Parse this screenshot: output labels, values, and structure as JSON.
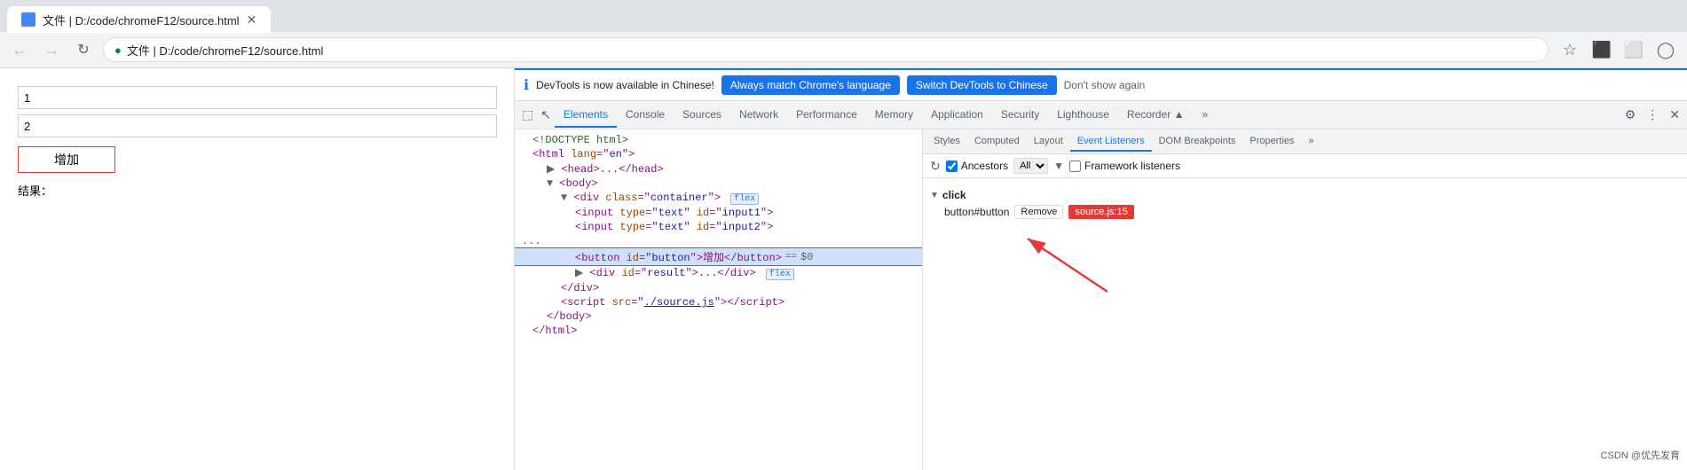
{
  "browser": {
    "tab_title": "文件 | D:/code/chromeF12/source.html",
    "address": "文件 | D:/code/chromeF12/source.html",
    "address_protocol": "文件",
    "address_path": "D:/code/chromeF12/source.html"
  },
  "page": {
    "input1_value": "1",
    "input2_value": "2",
    "button_label": "增加",
    "result_label": "结果："
  },
  "infobar": {
    "message": "DevTools is now available in Chinese!",
    "btn1": "Always match Chrome's language",
    "btn2": "Switch DevTools to Chinese",
    "dont_show": "Don't show again"
  },
  "devtools_tabs": {
    "tabs": [
      {
        "label": "Elements",
        "active": true
      },
      {
        "label": "Console",
        "active": false
      },
      {
        "label": "Sources",
        "active": false
      },
      {
        "label": "Network",
        "active": false
      },
      {
        "label": "Performance",
        "active": false
      },
      {
        "label": "Memory",
        "active": false
      },
      {
        "label": "Application",
        "active": false
      },
      {
        "label": "Security",
        "active": false
      },
      {
        "label": "Lighthouse",
        "active": false
      },
      {
        "label": "Recorder ▲",
        "active": false
      },
      {
        "label": "»",
        "active": false
      }
    ]
  },
  "elements_panel": {
    "lines": [
      {
        "text": "<!DOCTYPE html>",
        "indent": 1
      },
      {
        "text": "<html lang=\"en\">",
        "indent": 1
      },
      {
        "text": "▶ <head>...</head>",
        "indent": 2
      },
      {
        "text": "▼ <body>",
        "indent": 2
      },
      {
        "text": "▼ <div class=\"container\"> flex",
        "indent": 3,
        "badge": "flex"
      },
      {
        "text": "<input type=\"text\" id=\"input1\">",
        "indent": 4
      },
      {
        "text": "<input type=\"text\" id=\"input2\">",
        "indent": 4
      },
      {
        "text": "...",
        "indent": 3
      },
      {
        "text": "<button id=\"button\">增加</button>  == $0",
        "indent": 4,
        "selected": true
      },
      {
        "text": "▶ <div id=\"result\">...</div>  flex",
        "indent": 4,
        "badge": "flex"
      },
      {
        "text": "</div>",
        "indent": 3
      },
      {
        "text": "<script src=\"./source.js\"></script>",
        "indent": 3
      },
      {
        "text": "</body>",
        "indent": 2
      },
      {
        "text": "</html>",
        "indent": 1
      }
    ]
  },
  "right_panel": {
    "tabs": [
      {
        "label": "Styles",
        "active": false
      },
      {
        "label": "Computed",
        "active": false
      },
      {
        "label": "Layout",
        "active": false
      },
      {
        "label": "Event Listeners",
        "active": true
      },
      {
        "label": "DOM Breakpoints",
        "active": false
      },
      {
        "label": "Properties",
        "active": false
      },
      {
        "label": "»",
        "active": false
      }
    ],
    "event_toolbar": {
      "ancestors_label": "Ancestors",
      "all_option": "All",
      "framework_label": "Framework listeners"
    },
    "events": [
      {
        "name": "click",
        "items": [
          {
            "element": "button#button",
            "remove_label": "Remove",
            "source": "source.js:15"
          }
        ]
      }
    ]
  },
  "watermark": "CSDN @优先发育"
}
